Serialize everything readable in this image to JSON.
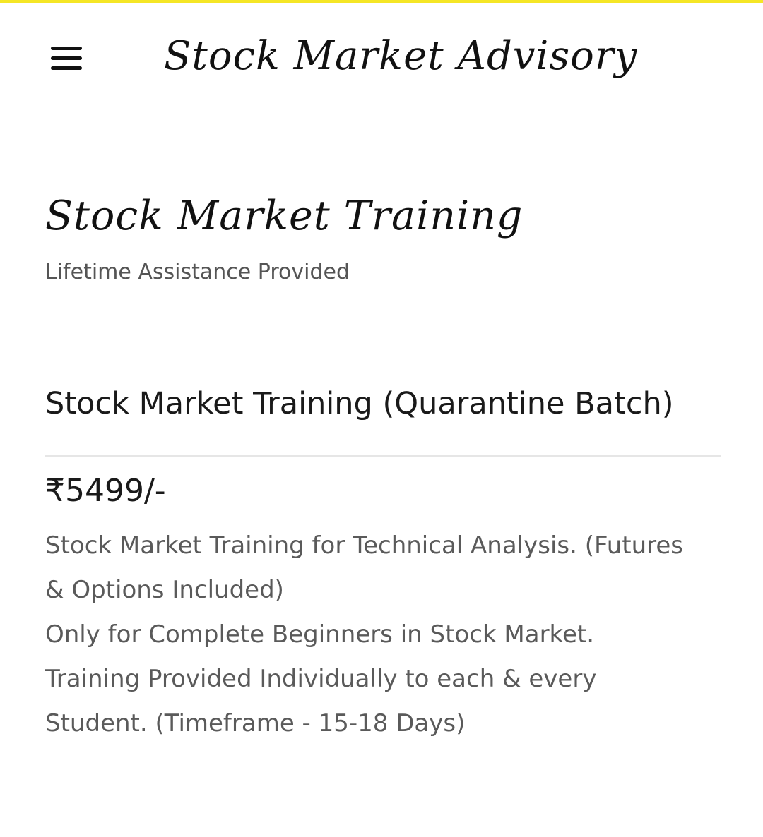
{
  "header": {
    "site_title": "Stock Market Advisory",
    "menu_icon": "hamburger-menu-icon",
    "accent_color": "#f5e626"
  },
  "main": {
    "page_title": "Stock Market Training",
    "subtitle": "Lifetime Assistance Provided"
  },
  "product": {
    "name": "Stock Market Training (Quarantine Batch)",
    "price": "₹5499/-",
    "description_lines": [
      "Stock Market Training for Technical Analysis. (Futures",
      "& Options Included)",
      "Only for Complete Beginners in Stock Market.",
      "Training Provided Individually to each & every",
      "Student. (Timeframe - 15-18   Days)"
    ]
  }
}
